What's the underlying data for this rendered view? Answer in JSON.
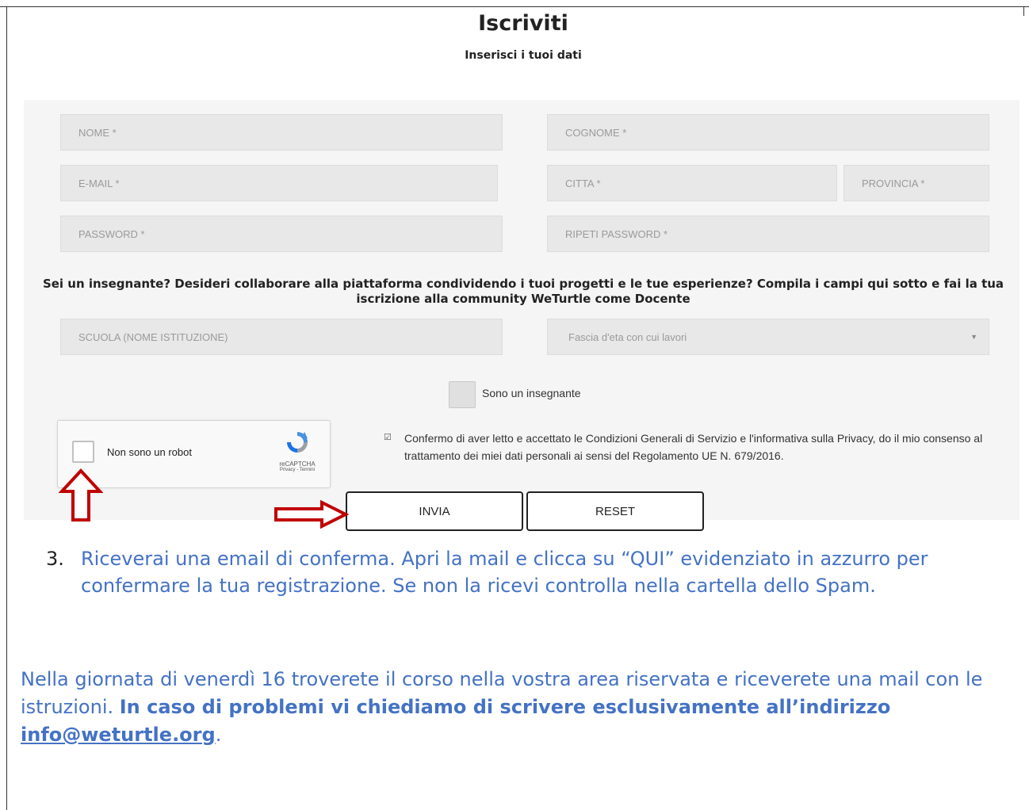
{
  "header": {
    "title": "Iscriviti",
    "subtitle": "Inserisci i tuoi dati"
  },
  "form": {
    "first_name_placeholder": "NOME *",
    "last_name_placeholder": "COGNOME *",
    "email_placeholder": "E-MAIL *",
    "city_placeholder": "CITTA *",
    "province_placeholder": "PROVINCIA *",
    "password_placeholder": "PASSWORD *",
    "repeat_password_placeholder": "RIPETI PASSWORD *",
    "teacher_prompt": "Sei un insegnante? Desideri collaborare alla piattaforma condividendo i tuoi progetti e le tue esperienze? Compila i campi qui sotto e fai la tua iscrizione alla community WeTurtle come Docente",
    "school_placeholder": "SCUOLA (NOME ISTITUZIONE)",
    "age_range_select": "Fascia d'eta con cui lavori",
    "teacher_checkbox_label": "Sono un insegnante",
    "captcha_label": "Non sono un robot",
    "captcha_brand": "reCAPTCHA",
    "captcha_links": "Privacy - Termini",
    "privacy_text": "Confermo di aver letto e accettato le Condizioni Generali di Servizio e l'informativa sulla Privacy, do il mio consenso al trattamento dei miei dati personali ai sensi del Regolamento UE N. 679/2016.",
    "submit_label": "INVIA",
    "reset_label": "RESET"
  },
  "colors": {
    "arrow": "#c00000",
    "instruction_text": "#4472c4",
    "field_bg": "#e8e8e8",
    "panel_bg": "#f5f5f5"
  },
  "instructions": {
    "step_number": "3.",
    "step_text": "Riceverai una email di conferma. Apri la mail e clicca su “QUI” evidenziato in azzurro per confermare la tua registrazione. Se non la ricevi controlla nella cartella dello Spam.",
    "note_text": "Nella giornata di venerdì 16 troverete il corso nella vostra area riservata e riceverete una mail con le istruzioni. ",
    "note_bold": "In caso di problemi vi chiediamo di scrivere esclusivamente all’indirizzo ",
    "email_link": "info@weturtle.org",
    "note_end": "."
  }
}
